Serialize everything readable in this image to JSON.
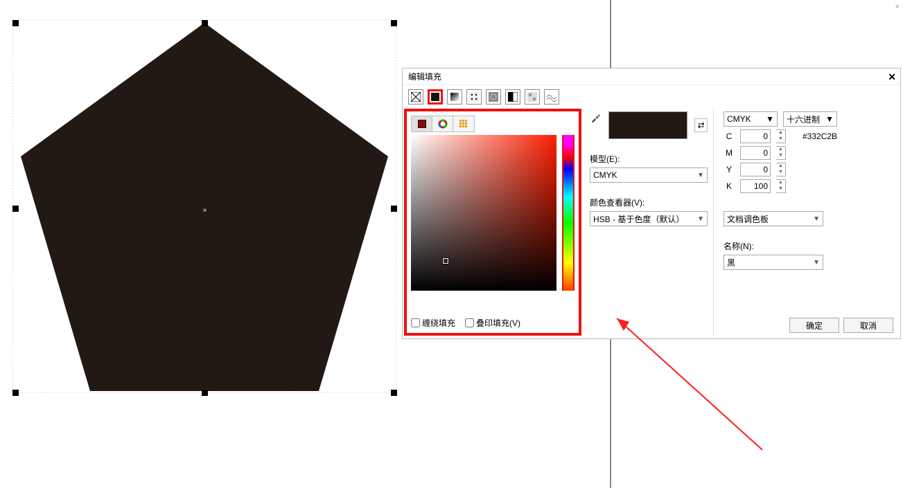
{
  "dialog": {
    "title": "编辑填充",
    "checkbox_wrap": "缠绕填充",
    "checkbox_overprint": "叠印填充(V)",
    "model_label": "模型(E):",
    "model_value": "CMYK",
    "viewer_label": "颜色查看器(V):",
    "viewer_value": "HSB - 基于色度（默认）",
    "colorspace": "CMYK",
    "hex_mode": "十六进制",
    "channels": {
      "C": "0",
      "M": "0",
      "Y": "0",
      "K": "100"
    },
    "hex": "#332C2B",
    "palette_label": "文档调色板",
    "name_label": "名称(N):",
    "name_value": "黑",
    "ok": "确定",
    "cancel": "取消"
  },
  "swatch_color": "#231914"
}
